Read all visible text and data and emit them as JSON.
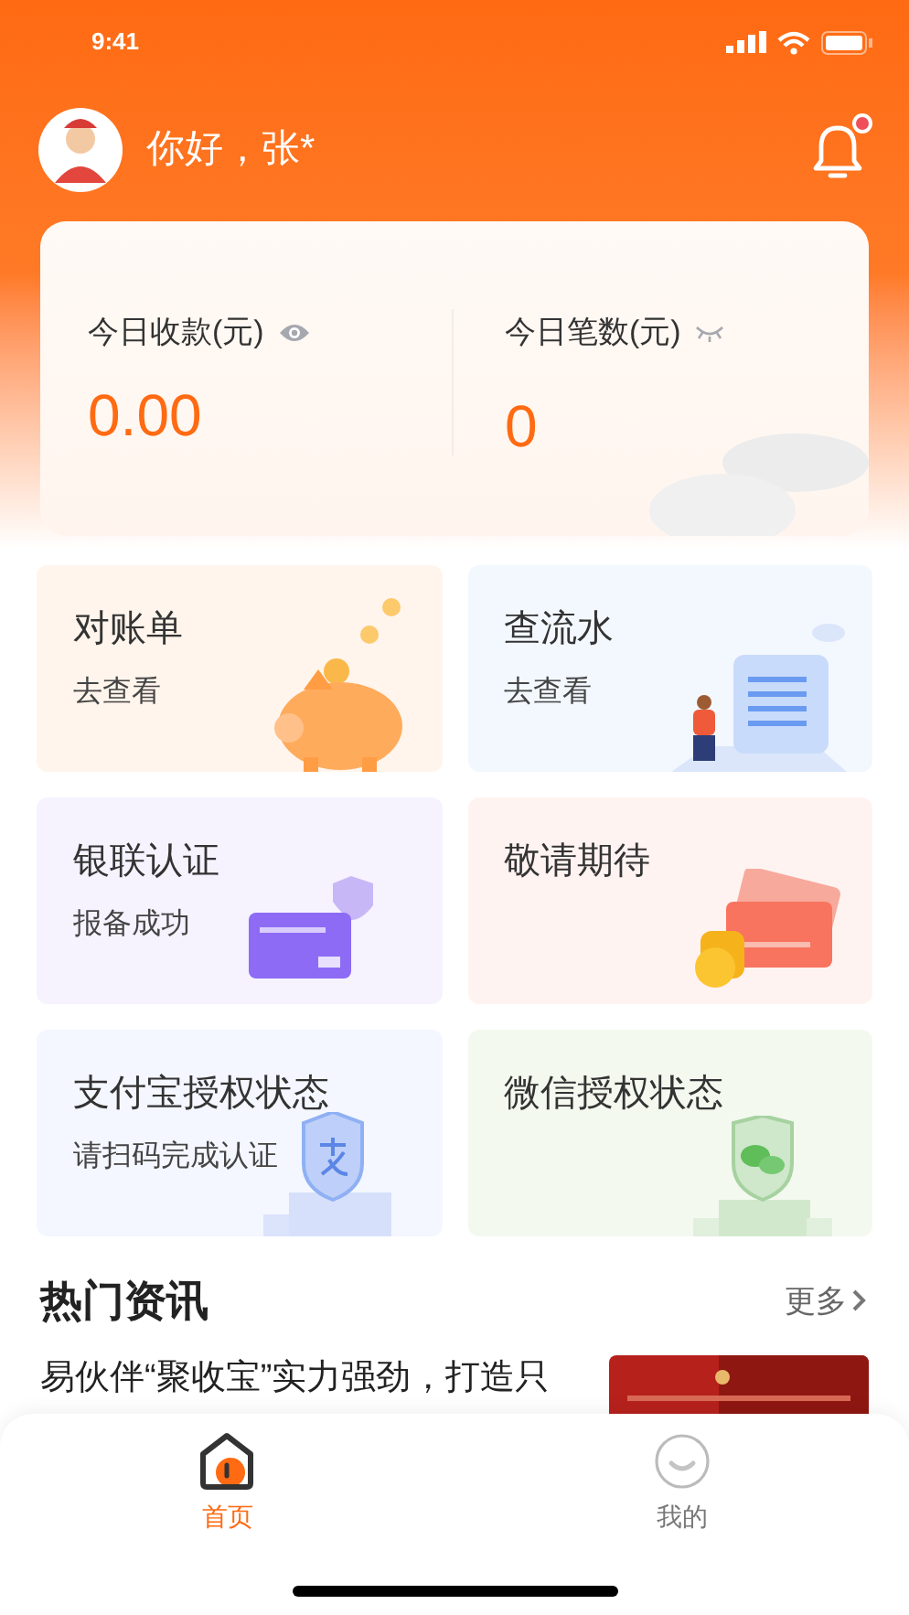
{
  "status_bar": {
    "time": "9:41"
  },
  "header": {
    "greeting": "你好，张*",
    "notification_unread": true
  },
  "stats": [
    {
      "label": "今日收款(元)",
      "value": "0.00",
      "visible": true
    },
    {
      "label": "今日笔数(元)",
      "value": "0",
      "visible": false
    }
  ],
  "tiles": [
    {
      "kind": "piggy",
      "title": "对账单",
      "subtitle": "去查看"
    },
    {
      "kind": "receipt",
      "title": "查流水",
      "subtitle": "去查看"
    },
    {
      "kind": "card",
      "title": "银联认证",
      "subtitle": "报备成功"
    },
    {
      "kind": "coins",
      "title": "敬请期待"
    },
    {
      "kind": "alipay",
      "title": "支付宝授权状态",
      "subtitle": "请扫码完成认证"
    },
    {
      "kind": "wechat",
      "title": "微信授权状态"
    }
  ],
  "news": {
    "title": "热门资讯",
    "more": "更多",
    "items": [
      {
        "title": "易伙伴“聚收宝”实力强劲，打造只"
      }
    ]
  },
  "tab_bar": [
    {
      "label": "首页",
      "kind": "home",
      "selected": true
    },
    {
      "label": "我的",
      "kind": "profile",
      "selected": false
    }
  ]
}
